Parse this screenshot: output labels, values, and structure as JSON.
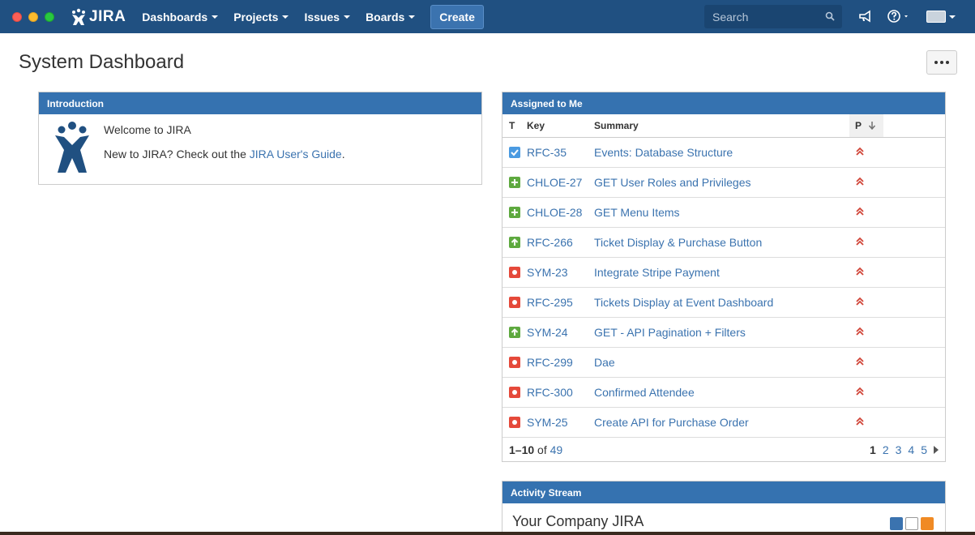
{
  "header": {
    "logo_text": "JIRA",
    "nav": [
      {
        "label": "Dashboards"
      },
      {
        "label": "Projects"
      },
      {
        "label": "Issues"
      },
      {
        "label": "Boards"
      }
    ],
    "create_label": "Create",
    "search_placeholder": "Search"
  },
  "page": {
    "title": "System Dashboard"
  },
  "introduction": {
    "title": "Introduction",
    "welcome": "Welcome to JIRA",
    "text_prefix": "New to JIRA? Check out the ",
    "link_text": "JIRA User's Guide",
    "text_suffix": "."
  },
  "assigned": {
    "title": "Assigned to Me",
    "columns": {
      "type": "T",
      "key": "Key",
      "summary": "Summary",
      "priority": "P"
    },
    "rows": [
      {
        "type": "task",
        "key": "RFC-35",
        "summary": "Events: Database Structure"
      },
      {
        "type": "new-feature",
        "key": "CHLOE-27",
        "summary": "GET User Roles and Privileges"
      },
      {
        "type": "new-feature",
        "key": "CHLOE-28",
        "summary": "GET Menu Items"
      },
      {
        "type": "improvement",
        "key": "RFC-266",
        "summary": "Ticket Display & Purchase Button"
      },
      {
        "type": "bug",
        "key": "SYM-23",
        "summary": "Integrate Stripe Payment"
      },
      {
        "type": "bug",
        "key": "RFC-295",
        "summary": "Tickets Display at Event Dashboard"
      },
      {
        "type": "improvement",
        "key": "SYM-24",
        "summary": "GET - API Pagination + Filters"
      },
      {
        "type": "bug",
        "key": "RFC-299",
        "summary": "Dae"
      },
      {
        "type": "bug",
        "key": "RFC-300",
        "summary": "Confirmed Attendee"
      },
      {
        "type": "bug",
        "key": "SYM-25",
        "summary": "Create API for Purchase Order"
      }
    ],
    "range": "1–10",
    "of_text": "of",
    "total": "49",
    "pages": [
      "1",
      "2",
      "3",
      "4",
      "5"
    ],
    "current_page": "1"
  },
  "activity": {
    "title": "Activity Stream",
    "heading": "Your Company JIRA"
  },
  "colors": {
    "header_bg": "#205081",
    "gadget_header": "#3572b0",
    "link": "#3b73af",
    "priority": "#d04437",
    "task": "#4a9ae1",
    "new_feature": "#5ea93f",
    "improvement": "#5ea93f",
    "bug": "#e5493a"
  }
}
